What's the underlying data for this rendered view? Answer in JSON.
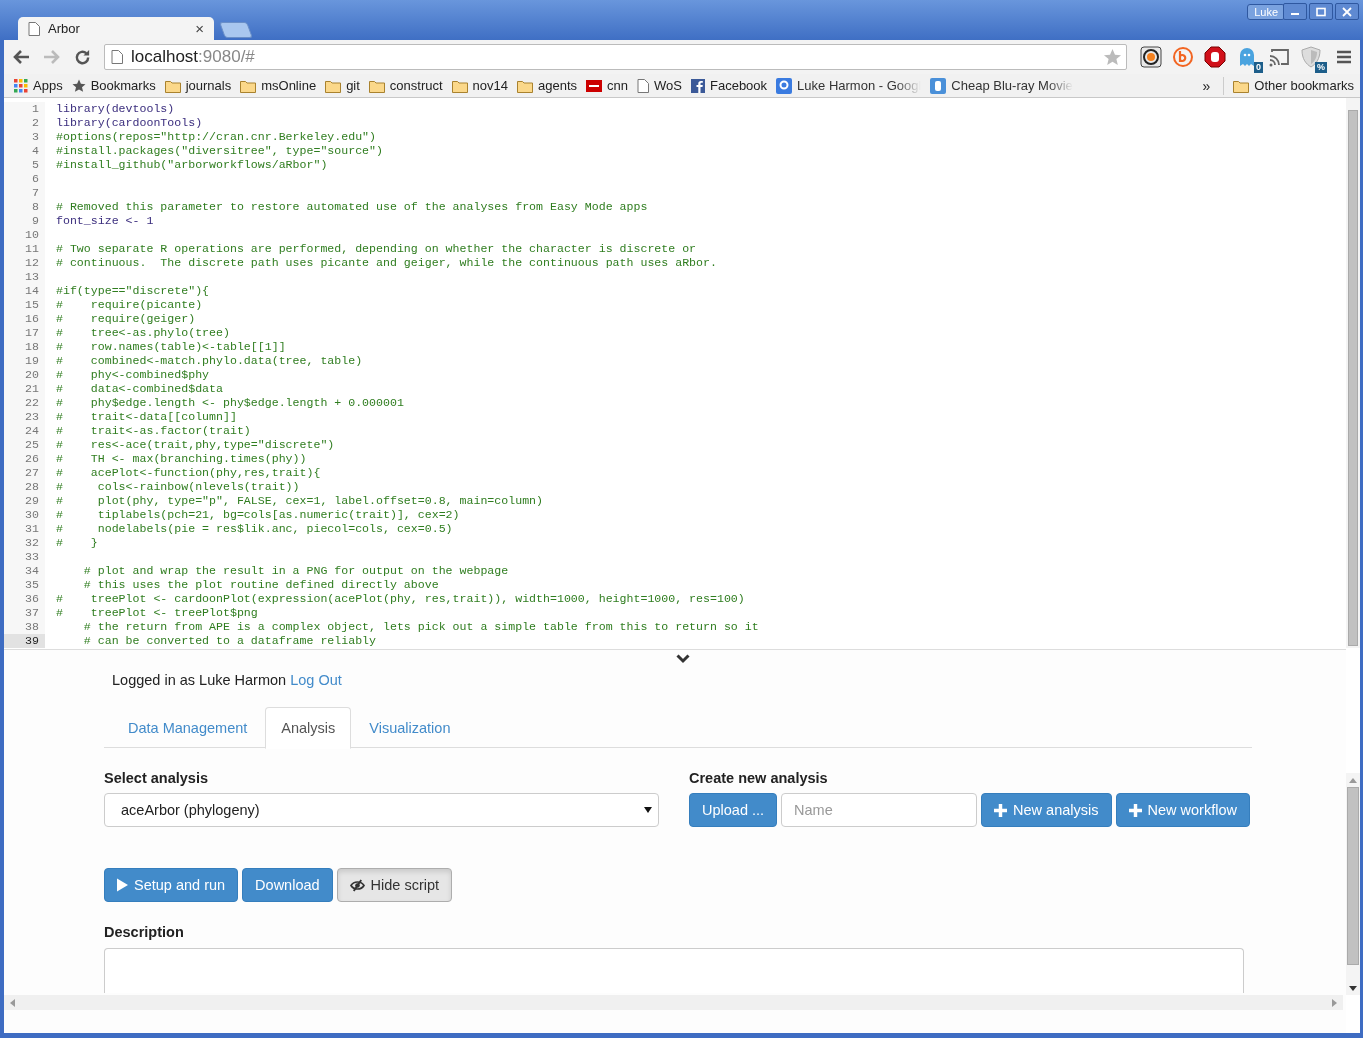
{
  "window": {
    "profile": "Luke"
  },
  "tabs": [
    {
      "title": "Arbor",
      "close": "×",
      "selected": true
    }
  ],
  "toolbar": {
    "back_disabled": false,
    "forward_disabled": true,
    "address_host": "localhost",
    "address_path": ":9080/#",
    "extensions": [
      {
        "kind": "s-circle"
      },
      {
        "kind": "b-circle"
      },
      {
        "kind": "stop-hand"
      },
      {
        "kind": "ghost",
        "badge": "0"
      },
      {
        "kind": "cast"
      },
      {
        "kind": "shield",
        "badge": "%"
      }
    ]
  },
  "bookmarks": {
    "items": [
      {
        "label": "Apps",
        "kind": "apps",
        "truncated": false
      },
      {
        "label": "Bookmarks",
        "kind": "star",
        "truncated": false
      },
      {
        "label": "journals",
        "kind": "folder",
        "truncated": false
      },
      {
        "label": "msOnline",
        "kind": "folder",
        "truncated": false
      },
      {
        "label": "git",
        "kind": "folder",
        "truncated": false
      },
      {
        "label": "construct",
        "kind": "folder",
        "truncated": false
      },
      {
        "label": "nov14",
        "kind": "folder",
        "truncated": false
      },
      {
        "label": "agents",
        "kind": "folder",
        "truncated": false
      },
      {
        "label": "cnn",
        "kind": "news",
        "truncated": false
      },
      {
        "label": "WoS",
        "kind": "page",
        "truncated": false
      },
      {
        "label": "Facebook",
        "kind": "facebook",
        "truncated": false
      },
      {
        "label": "Luke Harmon - Googl",
        "kind": "google",
        "truncated": true
      },
      {
        "label": "Cheap Blu-ray Movie",
        "kind": "blog",
        "truncated": true
      }
    ],
    "overflow": "»",
    "other": {
      "label": "Other bookmarks"
    }
  },
  "code_lines": [
    {
      "number": "1",
      "text": "library(devtools)",
      "kind": "code",
      "current": false
    },
    {
      "number": "2",
      "text": "library(cardoonTools)",
      "kind": "code",
      "current": false
    },
    {
      "number": "3",
      "text": "#options(repos=\"http://cran.cnr.Berkeley.edu\")",
      "kind": "comment",
      "current": false
    },
    {
      "number": "4",
      "text": "#install.packages(\"diversitree\", type=\"source\")",
      "kind": "comment",
      "current": false
    },
    {
      "number": "5",
      "text": "#install_github(\"arborworkflows/aRbor\")",
      "kind": "comment",
      "current": false
    },
    {
      "number": "6",
      "current": false
    },
    {
      "number": "7",
      "current": false
    },
    {
      "number": "8",
      "text": "# Removed this parameter to restore automated use of the analyses from Easy Mode apps",
      "kind": "comment",
      "current": false
    },
    {
      "number": "9",
      "text": "font_size <- 1",
      "kind": "code",
      "current": false
    },
    {
      "number": "10",
      "current": false
    },
    {
      "number": "11",
      "text": "# Two separate R operations are performed, depending on whether the character is discrete or",
      "kind": "comment",
      "current": false
    },
    {
      "number": "12",
      "text": "# continuous.  The discrete path uses picante and geiger, while the continuous path uses aRbor.",
      "kind": "comment",
      "current": false
    },
    {
      "number": "13",
      "current": false
    },
    {
      "number": "14",
      "text": "#if(type==\"discrete\"){",
      "kind": "comment",
      "current": false
    },
    {
      "number": "15",
      "text": "#    require(picante)",
      "kind": "comment",
      "current": false
    },
    {
      "number": "16",
      "text": "#    require(geiger)",
      "kind": "comment",
      "current": false
    },
    {
      "number": "17",
      "text": "#    tree<-as.phylo(tree)",
      "kind": "comment",
      "current": false
    },
    {
      "number": "18",
      "text": "#    row.names(table)<-table[[1]]",
      "kind": "comment",
      "current": false
    },
    {
      "number": "19",
      "text": "#    combined<-match.phylo.data(tree, table)",
      "kind": "comment",
      "current": false
    },
    {
      "number": "20",
      "text": "#    phy<-combined$phy",
      "kind": "comment",
      "current": false
    },
    {
      "number": "21",
      "text": "#    data<-combined$data",
      "kind": "comment",
      "current": false
    },
    {
      "number": "22",
      "text": "#    phy$edge.length <- phy$edge.length + 0.000001",
      "kind": "comment",
      "current": false
    },
    {
      "number": "23",
      "text": "#    trait<-data[[column]]",
      "kind": "comment",
      "current": false
    },
    {
      "number": "24",
      "text": "#    trait<-as.factor(trait)",
      "kind": "comment",
      "current": false
    },
    {
      "number": "25",
      "text": "#    res<-ace(trait,phy,type=\"discrete\")",
      "kind": "comment",
      "current": false
    },
    {
      "number": "26",
      "text": "#    TH <- max(branching.times(phy))",
      "kind": "comment",
      "current": false
    },
    {
      "number": "27",
      "text": "#    acePlot<-function(phy,res,trait){",
      "kind": "comment",
      "current": false
    },
    {
      "number": "28",
      "text": "#     cols<-rainbow(nlevels(trait))",
      "kind": "comment",
      "current": false
    },
    {
      "number": "29",
      "text": "#     plot(phy, type=\"p\", FALSE, cex=1, label.offset=0.8, main=column)",
      "kind": "comment",
      "current": false
    },
    {
      "number": "30",
      "text": "#     tiplabels(pch=21, bg=cols[as.numeric(trait)], cex=2)",
      "kind": "comment",
      "current": false
    },
    {
      "number": "31",
      "text": "#     nodelabels(pie = res$lik.anc, piecol=cols, cex=0.5)",
      "kind": "comment",
      "current": false
    },
    {
      "number": "32",
      "text": "#    }",
      "kind": "comment",
      "current": false
    },
    {
      "number": "33",
      "current": false
    },
    {
      "number": "34",
      "text": "    # plot and wrap the result in a PNG for output on the webpage",
      "kind": "comment",
      "current": false
    },
    {
      "number": "35",
      "text": "    # this uses the plot routine defined directly above",
      "kind": "comment",
      "current": false
    },
    {
      "number": "36",
      "text": "#    treePlot <- cardoonPlot(expression(acePlot(phy, res,trait)), width=1000, height=1000, res=100)",
      "kind": "comment",
      "current": false
    },
    {
      "number": "37",
      "text": "#    treePlot <- treePlot$png",
      "kind": "comment",
      "current": false
    },
    {
      "number": "38",
      "text": "    # the return from APE is a complex object, lets pick out a simple table from this to return so it",
      "kind": "comment",
      "current": false
    },
    {
      "number": "39",
      "text": "    # can be converted to a dataframe reliably",
      "kind": "comment",
      "current": true
    }
  ],
  "panel": {
    "login": {
      "text": "Logged in as Luke Harmon",
      "link": "Log Out"
    },
    "tabs": [
      {
        "label": "Data Management",
        "selected": false
      },
      {
        "label": "Analysis",
        "selected": true
      },
      {
        "label": "Visualization",
        "selected": false
      }
    ],
    "select_label": "Select analysis",
    "select_value": "aceArbor (phylogeny)",
    "create_label": "Create new analysis",
    "upload": "Upload ...",
    "name_placeholder": "Name",
    "new_analysis": "New analysis",
    "new_workflow": "New workflow",
    "actions": [
      {
        "label": "Setup and run",
        "kind": "run"
      },
      {
        "label": "Download",
        "kind": "plain"
      },
      {
        "label": "Hide script",
        "kind": "hide"
      }
    ],
    "description_label": "Description"
  }
}
